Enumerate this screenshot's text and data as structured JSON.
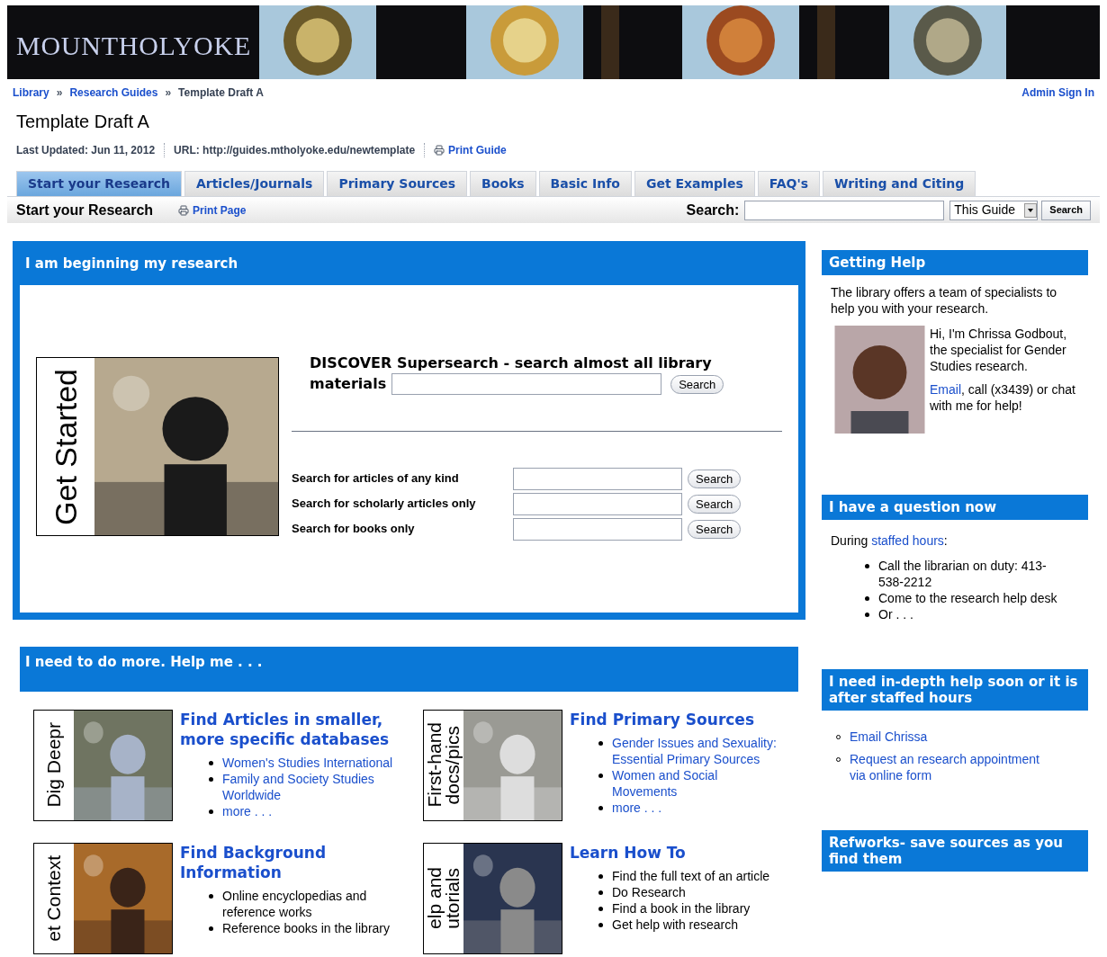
{
  "header": {
    "logo": "MOUNTHOLYOKE"
  },
  "breadcrumb": [
    "Library",
    "Research Guides",
    "Template Draft A"
  ],
  "breadcrumb_separator": "»",
  "admin_link": "Admin Sign In",
  "title": "Template Draft A",
  "meta": {
    "last_updated": "Last Updated: Jun 11, 2012",
    "url": "URL: http://guides.mtholyoke.edu/newtemplate",
    "print_guide": "Print Guide"
  },
  "tabs": [
    {
      "label": "Start your Research",
      "selected": true
    },
    {
      "label": "Articles/Journals",
      "selected": false
    },
    {
      "label": "Primary Sources",
      "selected": false
    },
    {
      "label": "Books",
      "selected": false
    },
    {
      "label": "Basic Info",
      "selected": false
    },
    {
      "label": "Get Examples",
      "selected": false
    },
    {
      "label": "FAQ's",
      "selected": false
    },
    {
      "label": "Writing and Citing",
      "selected": false
    }
  ],
  "subbar": {
    "page_title": "Start your Research",
    "print_page": "Print Page",
    "search_label": "Search:",
    "scope": "This Guide",
    "search_button": "Search"
  },
  "beginning": {
    "title": "I am beginning my research",
    "image_label": [
      "Get Started"
    ],
    "discover_label": [
      "DISCOVER Supersearch - search almost all library",
      "materials"
    ],
    "discover_button": "Search",
    "searches": [
      {
        "label": "Search for articles of any kind",
        "button": "Search"
      },
      {
        "label": "Search for scholarly articles only",
        "button": "Search"
      },
      {
        "label": "Search for books only",
        "button": "Search"
      }
    ]
  },
  "more": {
    "title": "I need to do more. Help me . . .",
    "cards": [
      {
        "image_label": [
          "Dig Deepr"
        ],
        "title": "Find Articles in smaller, more specific databases",
        "kind": "links",
        "items": [
          "Women's Studies International",
          "Family and Society Studies Worldwide",
          "more . . ."
        ]
      },
      {
        "image_label": [
          "First-hand",
          "docs/pics"
        ],
        "title": "Find Primary Sources",
        "kind": "links",
        "items": [
          "Gender Issues and Sexuality: Essential Primary Sources",
          "Women and Social Movements",
          "more . . ."
        ]
      },
      {
        "image_label": [
          "et Context"
        ],
        "title": "Find Background Information",
        "kind": "plain",
        "items": [
          "Online encyclopedias and reference works",
          "Reference books in the library"
        ]
      },
      {
        "image_label": [
          "elp and",
          "utorials"
        ],
        "title": "Learn How To",
        "kind": "plain",
        "items": [
          "Find the full text of an article",
          "Do Research",
          "Find a book in the library",
          "Get help with research"
        ]
      }
    ]
  },
  "sidebar": {
    "getting_help": {
      "title": "Getting Help",
      "intro": "The library offers a team of specialists to help you with your research.",
      "bio": "Hi, I'm Chrissa Godbout, the specialist for Gender Studies research.",
      "email_link": "Email",
      "contact": ", call (x3439) or chat with me for help!"
    },
    "question": {
      "title": "I have a question now",
      "lead": "During",
      "link": "staffed hours",
      "colon": ":",
      "items": [
        "Call the librarian on duty: 413-538-2212",
        "Come to the research help desk",
        "Or . . ."
      ]
    },
    "in_depth": {
      "title": "I need in-depth help soon or it is after staffed hours",
      "links": [
        "Email Chrissa",
        "Request an research appointment via online form"
      ]
    },
    "refworks": {
      "title": "Refworks- save sources as you find them"
    }
  }
}
